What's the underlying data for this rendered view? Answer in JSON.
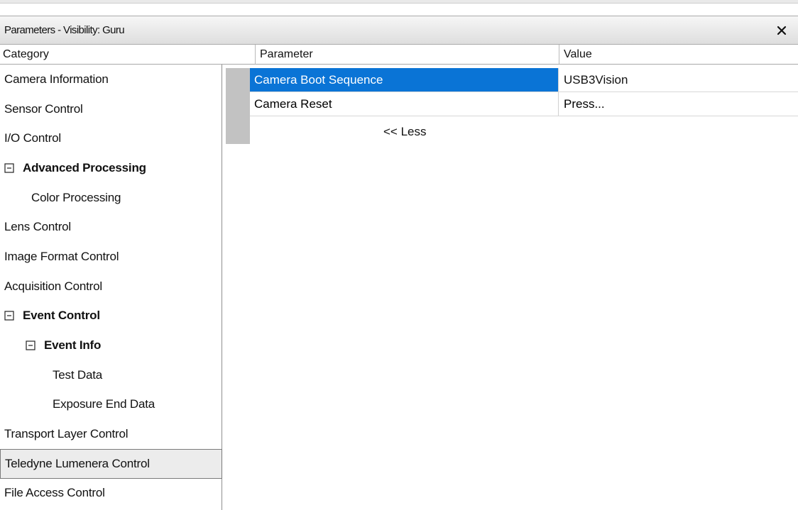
{
  "window": {
    "title": "Parameters - Visibility: Guru"
  },
  "columns": {
    "category": "Category",
    "parameter": "Parameter",
    "value": "Value"
  },
  "categories": [
    {
      "label": "Camera Information"
    },
    {
      "label": "Sensor Control"
    },
    {
      "label": "I/O Control"
    },
    {
      "label": "Advanced Processing",
      "toggle": "⊟"
    },
    {
      "label": "Color Processing"
    },
    {
      "label": "Lens Control"
    },
    {
      "label": "Image Format Control"
    },
    {
      "label": "Acquisition Control"
    },
    {
      "label": "Event Control",
      "toggle": "⊟"
    },
    {
      "label": "Event Info",
      "toggle": "⊟"
    },
    {
      "label": "Test Data"
    },
    {
      "label": "Exposure End Data"
    },
    {
      "label": "Transport Layer Control"
    },
    {
      "label": "Teledyne Lumenera Control",
      "selected": true
    },
    {
      "label": "File Access Control"
    }
  ],
  "parameters": [
    {
      "name": "Camera Boot Sequence",
      "value": "USB3Vision",
      "selected": true
    },
    {
      "name": "Camera Reset",
      "value": "Press..."
    }
  ],
  "less_label": "<< Less",
  "colors": {
    "selection": "#0a74d6",
    "row_header": "#c2c2c2"
  },
  "icons": {
    "close": "close-icon",
    "toggle": "collapse-icon"
  }
}
